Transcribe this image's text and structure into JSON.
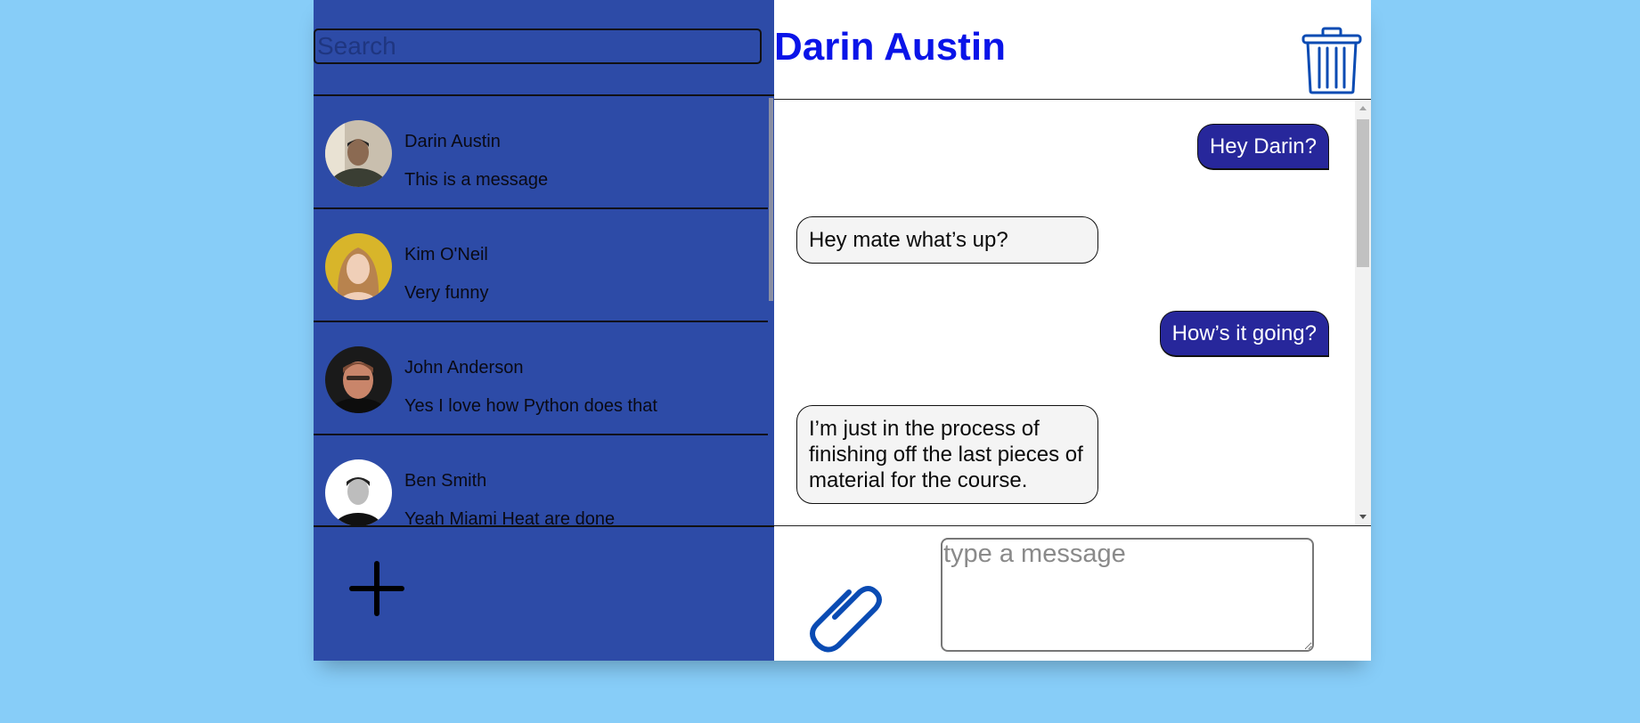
{
  "search": {
    "placeholder": "Search"
  },
  "conversations": [
    {
      "name": "Darin Austin",
      "preview": "This is a message",
      "avatar": "avatar-darin"
    },
    {
      "name": "Kim O'Neil",
      "preview": "Very funny",
      "avatar": "avatar-kim"
    },
    {
      "name": "John Anderson",
      "preview": "Yes I love how Python does that",
      "avatar": "avatar-john"
    },
    {
      "name": "Ben Smith",
      "preview": "Yeah Miami Heat are done",
      "avatar": "avatar-ben"
    }
  ],
  "chat": {
    "title": "Darin Austin",
    "messages": [
      {
        "direction": "sent",
        "text": "Hey Darin?"
      },
      {
        "direction": "received",
        "text": "Hey mate what’s up?"
      },
      {
        "direction": "sent",
        "text": "How’s it going?"
      },
      {
        "direction": "received",
        "text": "I’m just in the process of finishing off the last pieces of material for the course."
      }
    ]
  },
  "composer": {
    "placeholder": "type a message"
  },
  "icons": {
    "add": "plus-icon",
    "delete": "trash-icon",
    "attach": "paperclip-icon"
  },
  "colors": {
    "background": "#87cdf8",
    "sidebar": "#2d4ba7",
    "sent_bubble": "#27279b",
    "received_bubble": "#f4f4f4",
    "title": "#0a14e8",
    "icon_blue": "#0a4bb3"
  }
}
